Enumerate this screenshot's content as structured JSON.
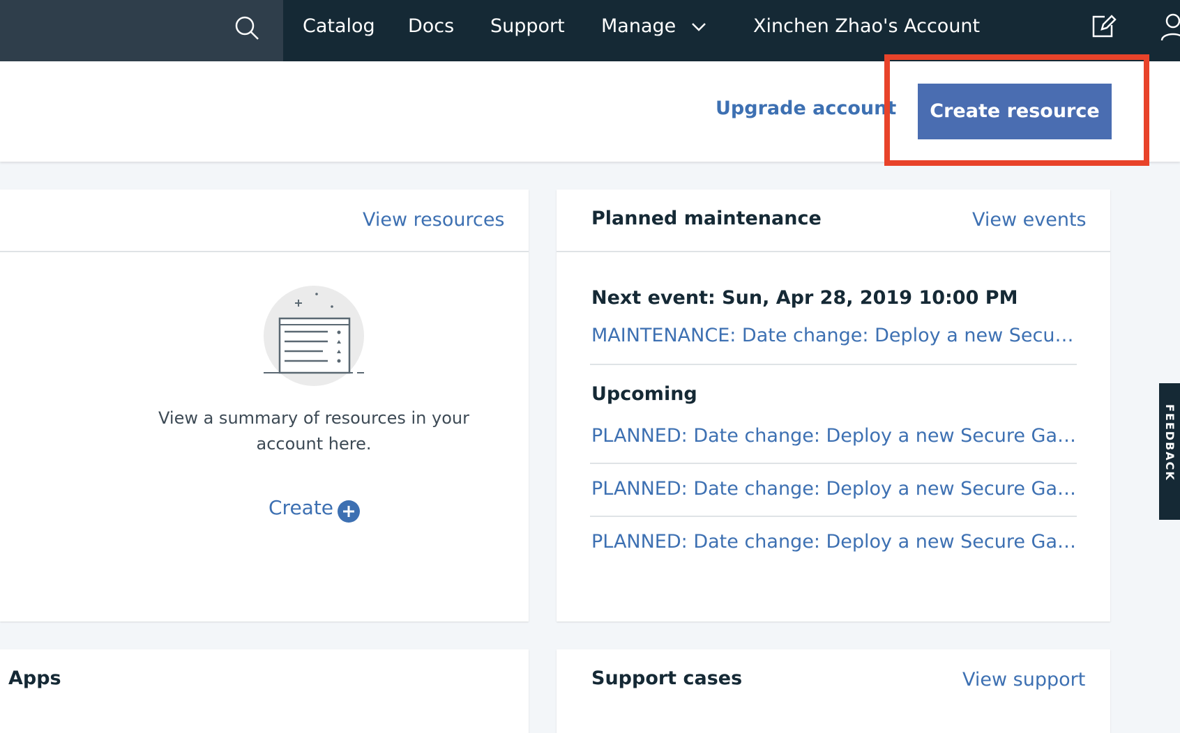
{
  "nav": {
    "items": [
      "Catalog",
      "Docs",
      "Support",
      "Manage",
      "Xinchen Zhao's Account"
    ]
  },
  "header": {
    "upgrade_label": "Upgrade account",
    "create_resource_label": "Create resource"
  },
  "resources_card": {
    "view_link": "View resources",
    "empty_text": "View a summary of resources in your account here.",
    "create_label": "Create"
  },
  "maintenance_card": {
    "title": "Planned maintenance",
    "view_link": "View events",
    "next_event": "Next event: Sun, Apr 28, 2019 10:00 PM",
    "next_event_link": "MAINTENANCE: Date change: Deploy a new Secure Gateway",
    "upcoming_heading": "Upcoming",
    "upcoming": [
      "PLANNED: Date change: Deploy a new Secure Gateway",
      "PLANNED: Date change: Deploy a new Secure Gateway",
      "PLANNED: Date change: Deploy a new Secure Gateway"
    ]
  },
  "apps_card": {
    "title": "Apps"
  },
  "support_card": {
    "title": "Support cases",
    "view_link": "View support"
  },
  "feedback_tab": "FEEDBACK",
  "colors": {
    "nav_bg": "#152935",
    "accent": "#3d70b2",
    "button": "#4a6db1",
    "highlight": "#e8432a"
  }
}
